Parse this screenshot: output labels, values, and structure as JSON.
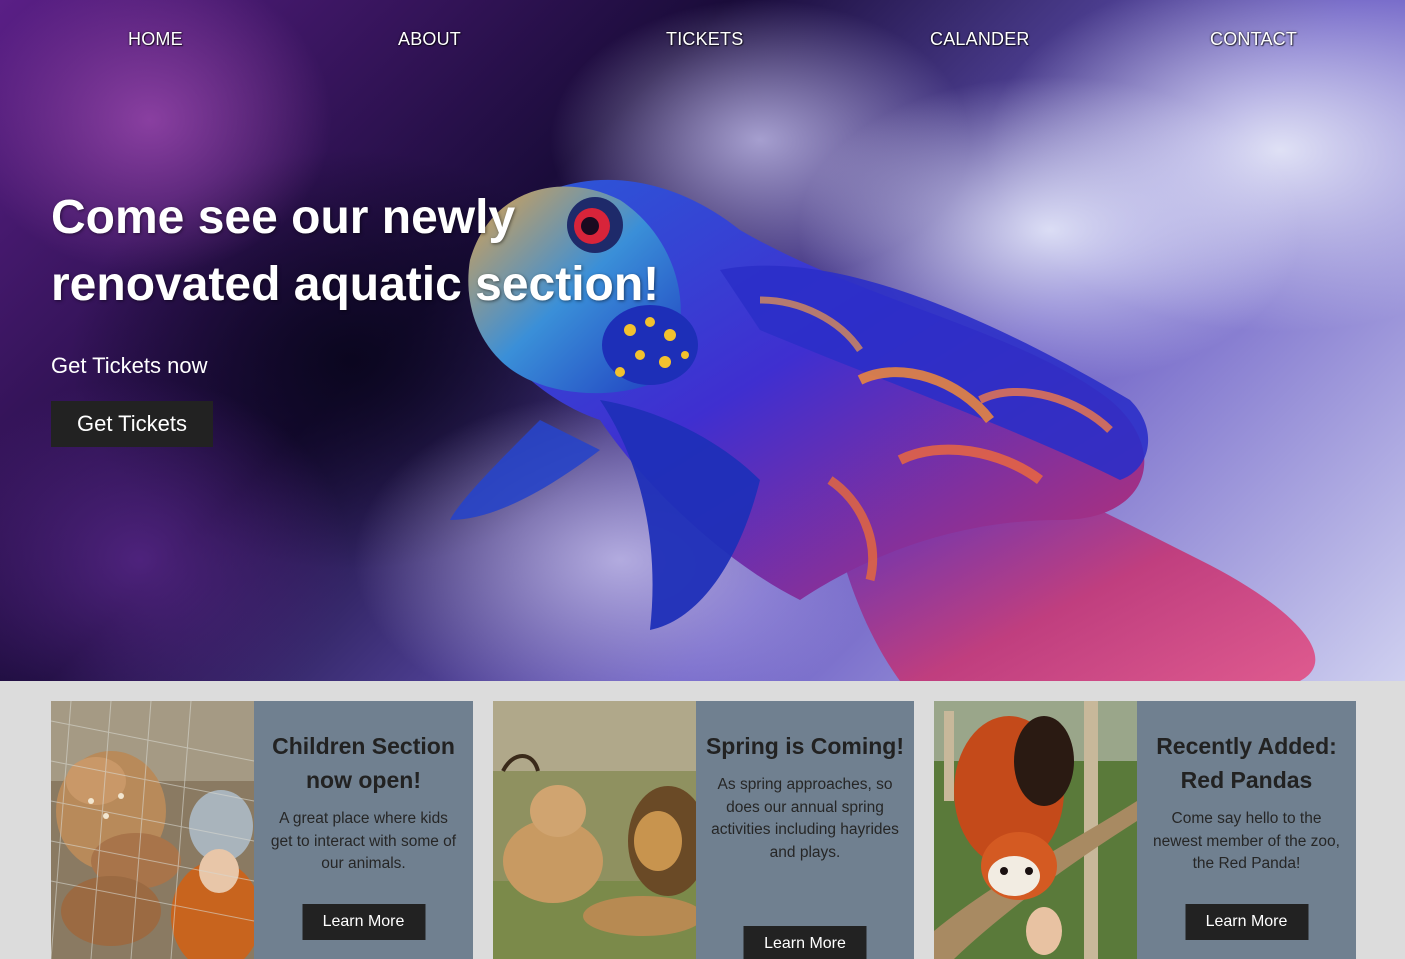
{
  "nav": {
    "items": [
      {
        "label": "HOME"
      },
      {
        "label": "ABOUT"
      },
      {
        "label": "TICKETS"
      },
      {
        "label": "CALANDER"
      },
      {
        "label": "CONTACT"
      }
    ]
  },
  "hero": {
    "title": "Come see our newly renovated aquatic section!",
    "subtitle": "Get Tickets now",
    "button_label": "Get Tickets",
    "image": "mandarin-fish-photo"
  },
  "cards": [
    {
      "title": "Children Section now open!",
      "text": "A great place where kids get to interact with some of our animals.",
      "button_label": "Learn More",
      "image": "child-feeding-deer-photo"
    },
    {
      "title": "Spring is Coming!",
      "text": "As spring approaches, so does our annual spring activities including hayrides and plays.",
      "button_label": "Learn More",
      "image": "lions-photo"
    },
    {
      "title": "Recently Added: Red Pandas",
      "text": "Come say hello to the newest member of the zoo, the Red Panda!",
      "button_label": "Learn More",
      "image": "red-panda-photo"
    }
  ],
  "colors": {
    "card_background": "#708090",
    "button_background": "#222222",
    "page_background": "#dcdcdc"
  }
}
